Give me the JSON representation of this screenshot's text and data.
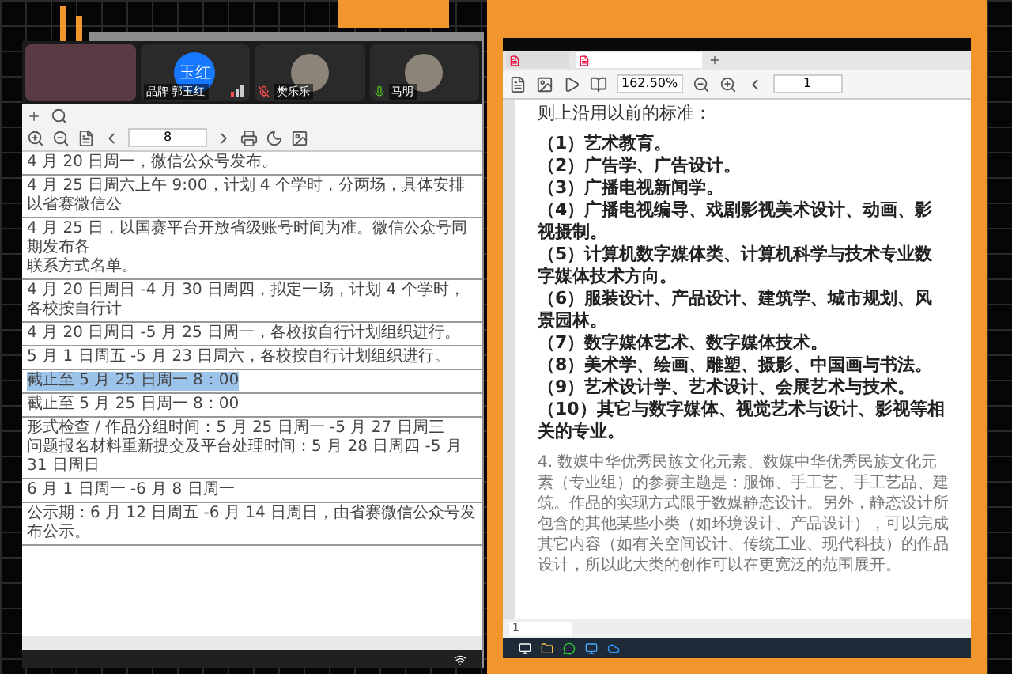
{
  "call": {
    "participants": [
      {
        "kind": "full_photo"
      },
      {
        "kind": "initials",
        "initials": "玉红",
        "name": "品牌 郭玉红",
        "signal": true
      },
      {
        "kind": "photo",
        "name": "樊乐乐",
        "muted": true
      },
      {
        "kind": "photo",
        "name": "马明",
        "muted": false
      }
    ]
  },
  "left_document": {
    "page": "8",
    "rows": [
      {
        "lines": [
          "4 月 20 日周一，微信公众号发布。"
        ],
        "selected": false
      },
      {
        "lines": [
          "4 月 25 日周六上午 9:00，计划 4 个学时，分两场，具体安排以省赛微信公"
        ],
        "selected": false
      },
      {
        "lines": [
          "4 月 25 日，以国赛平台开放省级账号时间为准。微信公众号同期发布各",
          "联系方式名单。"
        ],
        "selected": false
      },
      {
        "lines": [
          "4 月 20 日周日 -4 月 30 日周四，拟定一场，计划 4 个学时，各校按自行计"
        ],
        "selected": false
      },
      {
        "lines": [
          "4 月 20 日周日 -5 月 25 日周一，各校按自行计划组织进行。"
        ],
        "selected": false
      },
      {
        "lines": [
          "5 月 1 日周五 -5 月 23 日周六，各校按自行计划组织进行。"
        ],
        "selected": false
      },
      {
        "lines": [
          "截止至 5 月 25 日周一 8：00"
        ],
        "selected": true
      },
      {
        "lines": [
          "截止至 5 月 25 日周一 8：00"
        ],
        "selected": false
      },
      {
        "lines": [
          "形式检查 / 作品分组时间：5 月 25 日周一 -5 月 27 日周三",
          "问题报名材料重新提交及平台处理时间：5 月 28 日周四 -5 月 31 日周日"
        ],
        "selected": false
      },
      {
        "lines": [
          "6 月 1 日周一 -6 月 8 日周一"
        ],
        "selected": false
      },
      {
        "lines": [
          "公示期：6 月 12 日周五 -6 月 14 日周日，由省赛微信公众号发布公示。"
        ],
        "selected": false
      }
    ]
  },
  "right_document": {
    "zoom": "162.50%",
    "page": "1",
    "footer_page": "1",
    "intro": "则上沿用以前的标准：",
    "items": [
      "（1）艺术教育。",
      "（2）广告学、广告设计。",
      "（3）广播电视新闻学。",
      "（4）广播电视编导、戏剧影视美术设计、动画、影视摄制。",
      "（5）计算机数字媒体类、计算机科学与技术专业数字媒体技术方向。",
      "（6）服装设计、产品设计、建筑学、城市规划、风景园林。",
      "（7）数字媒体艺术、数字媒体技术。",
      "（8）美术学、绘画、雕塑、摄影、中国画与书法。",
      "（9）艺术设计学、艺术设计、会展艺术与技术。",
      "（10）其它与数字媒体、视觉艺术与设计、影视等相关的专业。"
    ],
    "paragraph": "4. 数媒中华优秀民族文化元素、数媒中华优秀民族文化元素（专业组）的参赛主题是：服饰、手工艺、手工艺品、建筑。作品的实现方式限于数媒静态设计。另外，静态设计所包含的其他某些小类（如环境设计、产品设计），可以完成其它内容（如有关空间设计、传统工业、现代科技）的作品设计，所以此大类的创作可以在更宽泛的范围展开。"
  }
}
